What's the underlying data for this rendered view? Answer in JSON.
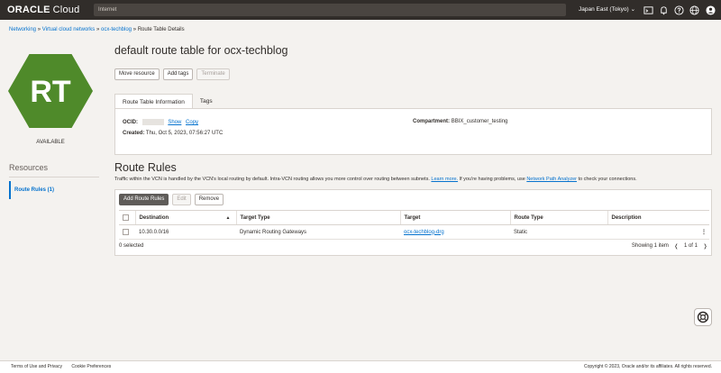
{
  "topbar": {
    "brand_main": "ORACLE",
    "brand_sub": "Cloud",
    "search_value": "Internet",
    "region_label": "Japan East (Tokyo)",
    "region_chevron": "⌄"
  },
  "breadcrumb": {
    "items": [
      "Networking",
      "Virtual cloud networks",
      "ocx-techblog"
    ],
    "separator": "»",
    "current": "Route Table Details"
  },
  "resource_badge": {
    "letters": "RT",
    "status": "AVAILABLE",
    "color": "#4f8a2a"
  },
  "sidebar": {
    "heading": "Resources",
    "items": [
      {
        "label": "Route Rules (1)"
      }
    ]
  },
  "page": {
    "title": "default route table for ocx-techblog",
    "actions": [
      "Move resource",
      "Add tags",
      "Terminate"
    ]
  },
  "tabs": {
    "info_label": "Route Table Information",
    "tags_label": "Tags"
  },
  "info": {
    "ocid_label": "OCID:",
    "show_label": "Show",
    "copy_label": "Copy",
    "created_label": "Created:",
    "created_value": "Thu, Oct 5, 2023, 07:56:27 UTC",
    "compartment_label": "Compartment:",
    "compartment_value": "BBIX_customer_testing"
  },
  "route_rules": {
    "title": "Route Rules",
    "desc_1": "Traffic within the VCN is handled by the VCN's local routing by default. Intra-VCN routing allows you more control over routing between subnets.",
    "learn_more": "Learn more.",
    "desc_2": "If you're having problems, use",
    "analyzer_link": "Network Path Analyzer",
    "desc_3": "to check your connections.",
    "buttons": {
      "add": "Add Route Rules",
      "edit": "Edit",
      "remove": "Remove"
    },
    "columns": [
      "Destination",
      "Target Type",
      "Target",
      "Route Type",
      "Description"
    ],
    "sort_icon": "▲",
    "rows": [
      {
        "destination": "10.30.0.0/16",
        "target_type": "Dynamic Routing Gateways",
        "target": "ocx-techblog-drg",
        "route_type": "Static",
        "description": ""
      }
    ],
    "selected_text": "0 selected",
    "showing_text": "Showing 1 item",
    "pager_text": "1 of 1"
  },
  "footer": {
    "terms": "Terms of Use and Privacy",
    "cookies": "Cookie Preferences",
    "copyright": "Copyright © 2023, Oracle and/or its affiliates. All rights reserved."
  }
}
